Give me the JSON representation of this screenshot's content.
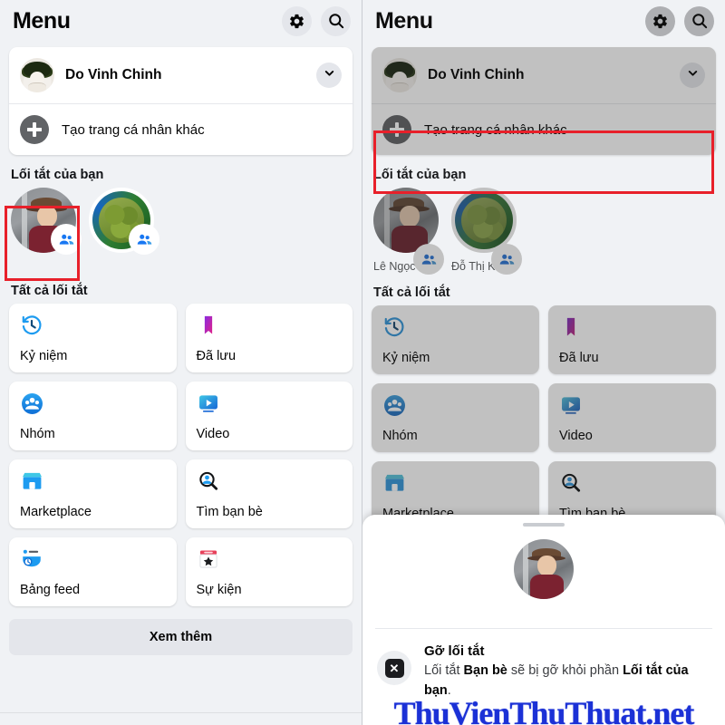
{
  "header": {
    "title": "Menu",
    "settings_icon": "gear-icon",
    "search_icon": "search-icon"
  },
  "profile": {
    "name": "Do Vinh Chinh",
    "expand_icon": "chevron-down-icon",
    "create_label": "Tạo trang cá nhân khác",
    "create_icon": "plus-circle-icon"
  },
  "shortcuts_section": {
    "title": "Lối tắt của bạn",
    "items": [
      {
        "name": "Lê Ngọc Đại",
        "badge": "group-icon"
      },
      {
        "name": "Đỗ Thị Khen",
        "badge": "group-icon"
      }
    ]
  },
  "all_shortcuts_section": {
    "title": "Tất cả lối tắt",
    "tiles": [
      {
        "label": "Kỷ niệm",
        "icon": "clock-rewind-icon"
      },
      {
        "label": "Đã lưu",
        "icon": "bookmark-icon"
      },
      {
        "label": "Nhóm",
        "icon": "groups-icon"
      },
      {
        "label": "Video",
        "icon": "video-play-icon"
      },
      {
        "label": "Marketplace",
        "icon": "storefront-icon"
      },
      {
        "label": "Tìm bạn bè",
        "icon": "find-friends-icon"
      },
      {
        "label": "Bảng feed",
        "icon": "feed-icon"
      },
      {
        "label": "Sự kiện",
        "icon": "calendar-star-icon"
      }
    ],
    "see_more_label": "Xem thêm"
  },
  "bottom_sheet": {
    "handle": "drag-handle",
    "avatar": "shortcut-avatar",
    "action": {
      "icon": "close-x-icon",
      "title": "Gỡ lối tắt",
      "desc_parts": [
        {
          "text": "Lối tắt ",
          "bold": false
        },
        {
          "text": "Bạn bè",
          "bold": true
        },
        {
          "text": " sẽ bị gỡ khỏi phần ",
          "bold": false
        },
        {
          "text": "Lối tắt của bạn",
          "bold": true
        },
        {
          "text": ".",
          "bold": false
        }
      ],
      "desc_plain": "Lối tắt Bạn bè sẽ bị gỡ khỏi phần Lối tắt của bạn."
    }
  },
  "watermark": {
    "text": "ThuVienThuThuat.net",
    "color": "#1b31d6"
  },
  "annotations": {
    "highlight_color": "#e8202a",
    "boxes": [
      {
        "target": "shortcut-item-0",
        "panel": "left"
      },
      {
        "target": "remove-shortcut-row",
        "panel": "right"
      }
    ]
  }
}
